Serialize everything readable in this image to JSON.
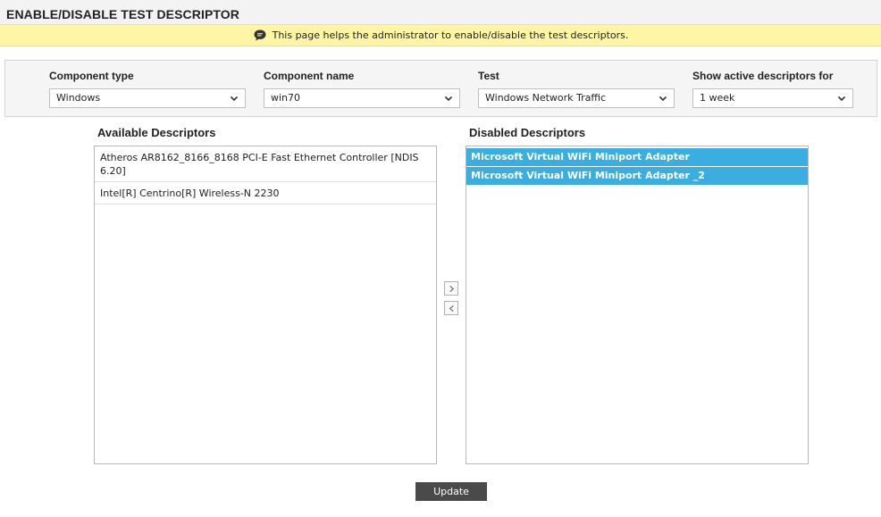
{
  "header": {
    "title": "ENABLE/DISABLE TEST DESCRIPTOR"
  },
  "banner": {
    "text": "This page helps the administrator to enable/disable the test descriptors."
  },
  "filters": [
    {
      "label": "Component type",
      "value": "Windows"
    },
    {
      "label": "Component name",
      "value": "win70"
    },
    {
      "label": "Test",
      "value": "Windows Network Traffic"
    },
    {
      "label": "Show active descriptors for",
      "value": "1 week"
    }
  ],
  "available": {
    "heading": "Available Descriptors",
    "items": [
      "Atheros AR8162_8166_8168 PCI-E Fast Ethernet Controller [NDIS 6.20]",
      "Intel[R] Centrino[R] Wireless-N 2230"
    ]
  },
  "disabled": {
    "heading": "Disabled Descriptors",
    "items": [
      "Microsoft Virtual WiFi Miniport Adapter",
      "Microsoft Virtual WiFi Miniport Adapter _2"
    ]
  },
  "actions": {
    "update_label": "Update"
  },
  "colors": {
    "selected": "#3aaee0",
    "banner": "#fff6a5",
    "button": "#4a4a4a"
  },
  "icons": {
    "banner": "speech-bubble-icon",
    "move_right": "chevron-right-icon",
    "move_left": "chevron-left-icon",
    "dropdown": "chevron-down-icon"
  }
}
